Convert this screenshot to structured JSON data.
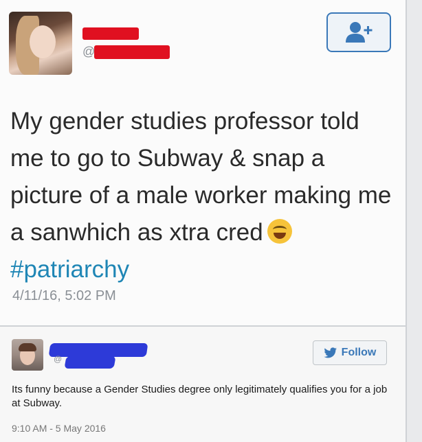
{
  "tweet1": {
    "handle_prefix": "@",
    "text": "My gender studies professor told me to go to Subway & snap a picture of a male worker making me a sanwhich as xtra cred",
    "hashtag": "#patriarchy",
    "timestamp": "4/11/16, 5:02 PM",
    "follow_icon": "add-user-icon"
  },
  "tweet2": {
    "handle_prefix": "@",
    "text": "Its funny because a Gender Studies degree only legitimately qualifies you for a job at Subway.",
    "timestamp": "9:10 AM - 5 May 2016",
    "follow_label": "Follow",
    "follow_icon": "twitter-bird-icon"
  },
  "colors": {
    "link": "#1f86b5",
    "follow_border": "#3a78b8",
    "red_redaction": "#e01020",
    "blue_redaction": "#2d3ad8"
  }
}
